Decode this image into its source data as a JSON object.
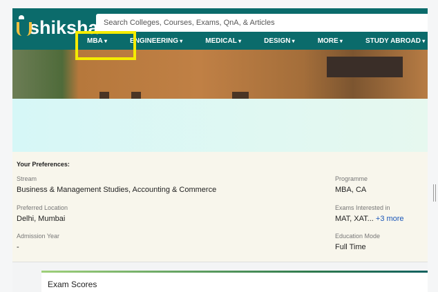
{
  "header": {
    "logo_text": "shiksha",
    "search_placeholder": "Search Colleges, Courses, Exams, QnA, & Articles",
    "nav": [
      "MBA",
      "ENGINEERING",
      "MEDICAL",
      "DESIGN",
      "MORE",
      "STUDY ABROAD"
    ]
  },
  "preferences": {
    "title": "Your Preferences:",
    "fields": [
      {
        "label": "Stream",
        "value": "Business & Management Studies, Accounting & Commerce"
      },
      {
        "label": "Programme",
        "value": "MBA, CA"
      },
      {
        "label": "Preferred Location",
        "value": "Delhi, Mumbai"
      },
      {
        "label": "Exams Interested in",
        "value": "MAT, XAT...",
        "link": "+3 more"
      },
      {
        "label": "Admission Year",
        "value": "-"
      },
      {
        "label": "Education Mode",
        "value": "Full Time"
      }
    ]
  },
  "exam_scores": {
    "title": "Exam Scores"
  },
  "colors": {
    "header": "#0b6b6b",
    "highlight": "#f5ec00",
    "link": "#1a56b8"
  }
}
